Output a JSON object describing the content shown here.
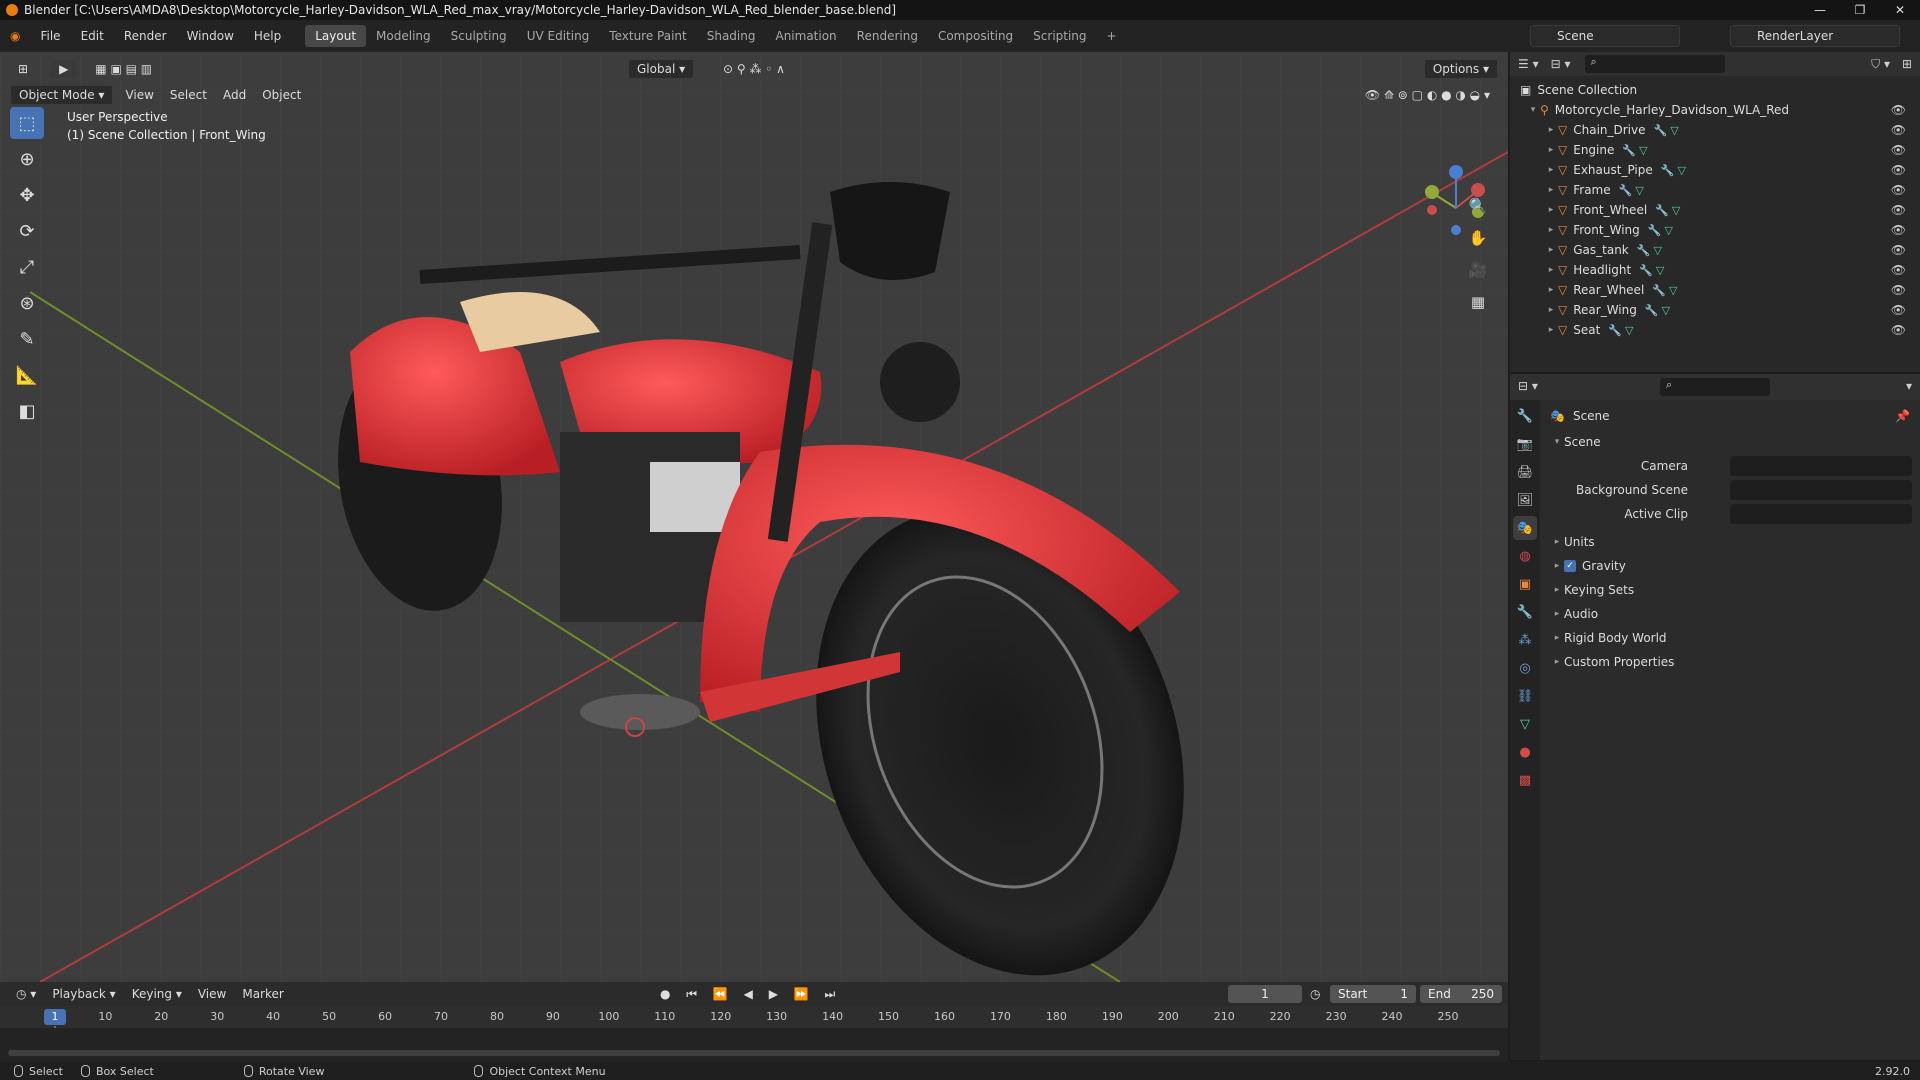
{
  "window": {
    "title": "Blender [C:\\Users\\AMDA8\\Desktop\\Motorcycle_Harley-Davidson_WLA_Red_max_vray/Motorcycle_Harley-Davidson_WLA_Red_blender_base.blend]",
    "controls": [
      "—",
      "❐",
      "✕"
    ]
  },
  "menu": [
    "File",
    "Edit",
    "Render",
    "Window",
    "Help"
  ],
  "workspaces": [
    "Layout",
    "Modeling",
    "Sculpting",
    "UV Editing",
    "Texture Paint",
    "Shading",
    "Animation",
    "Rendering",
    "Compositing",
    "Scripting"
  ],
  "active_workspace": "Layout",
  "scene_name": "Scene",
  "view_layer": "RenderLayer",
  "viewport": {
    "mode": "Object Mode",
    "menus": [
      "View",
      "Select",
      "Add",
      "Object"
    ],
    "transform_orientation": "Global",
    "options_label": "Options",
    "info_line1": "User Perspective",
    "info_line2": "(1) Scene Collection | Front_Wing"
  },
  "outliner": {
    "root": "Scene Collection",
    "collection": "Motorcycle_Harley_Davidson_WLA_Red",
    "objects": [
      "Chain_Drive",
      "Engine",
      "Exhaust_Pipe",
      "Frame",
      "Front_Wheel",
      "Front_Wing",
      "Gas_tank",
      "Headlight",
      "Rear_Wheel",
      "Rear_Wing",
      "Seat"
    ]
  },
  "properties": {
    "context": "Scene",
    "section": "Scene",
    "rows": [
      {
        "label": "Camera"
      },
      {
        "label": "Background Scene"
      },
      {
        "label": "Active Clip"
      }
    ],
    "panels": [
      "Units",
      "Gravity",
      "Keying Sets",
      "Audio",
      "Rigid Body World",
      "Custom Properties"
    ],
    "gravity_checked": true
  },
  "timeline": {
    "menus": [
      "Playback",
      "Keying",
      "View",
      "Marker"
    ],
    "current_frame": "1",
    "start_label": "Start",
    "start": "1",
    "end_label": "End",
    "end": "250",
    "ticks": [
      "1",
      "10",
      "20",
      "30",
      "40",
      "50",
      "60",
      "70",
      "80",
      "90",
      "100",
      "110",
      "120",
      "130",
      "140",
      "150",
      "160",
      "170",
      "180",
      "190",
      "200",
      "210",
      "220",
      "230",
      "240",
      "250"
    ]
  },
  "statusbar": {
    "items": [
      "Select",
      "Box Select",
      "Rotate View",
      "Object Context Menu"
    ],
    "version": "2.92.0"
  }
}
